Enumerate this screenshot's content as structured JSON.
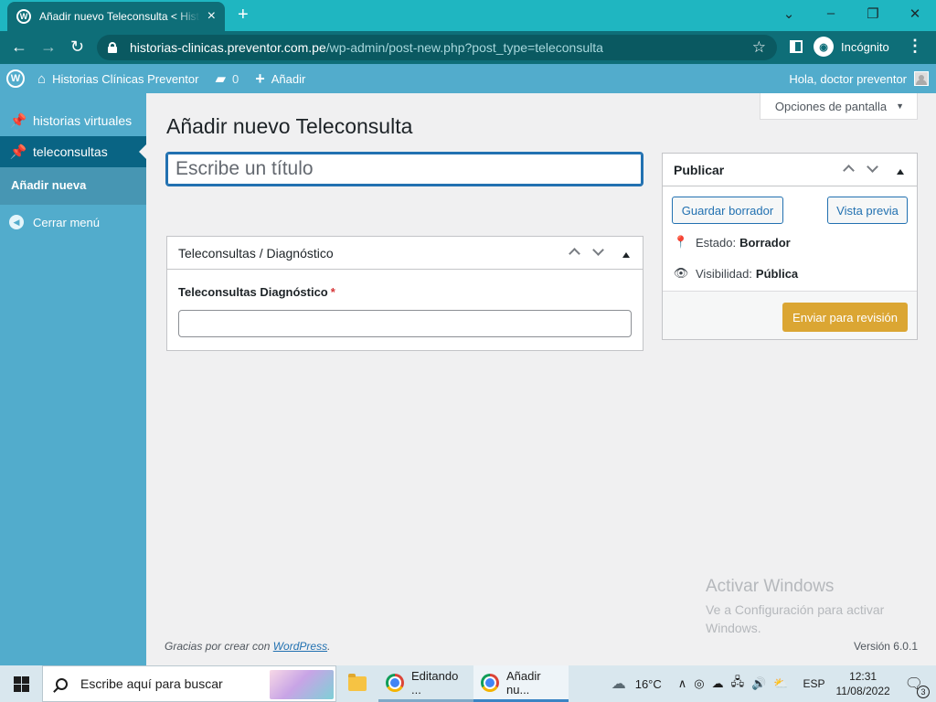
{
  "browser": {
    "tab_title": "Añadir nuevo Teleconsulta < Historias Clínicas Preventor",
    "url_host": "historias-clinicas.preventor.com.pe",
    "url_path": "/wp-admin/post-new.php?post_type=teleconsulta",
    "incognito_label": "Incógnito"
  },
  "adminbar": {
    "site_name": "Historias Clínicas Preventor",
    "comments_count": "0",
    "new_label": "Añadir",
    "howdy": "Hola, doctor preventor"
  },
  "sidebar": {
    "items": [
      {
        "label": "historias virtuales",
        "icon": "pin-icon"
      },
      {
        "label": "teleconsultas",
        "icon": "pin-icon",
        "current": true
      }
    ],
    "submenu": [
      "Añadir nueva"
    ],
    "collapse_label": "Cerrar menú"
  },
  "main": {
    "screen_options": "Opciones de pantalla",
    "page_title": "Añadir nuevo Teleconsulta",
    "title_placeholder": "Escribe un título",
    "diagnostic_box": {
      "title": "Teleconsultas / Diagnóstico",
      "field_label": "Teleconsultas Diagnóstico",
      "required_mark": "*"
    },
    "publish_box": {
      "title": "Publicar",
      "save_draft": "Guardar borrador",
      "preview": "Vista previa",
      "status_label": "Estado:",
      "status_value": "Borrador",
      "visibility_label": "Visibilidad:",
      "visibility_value": "Pública",
      "submit": "Enviar para revisión"
    },
    "footer_text": "Gracias por crear con",
    "footer_link": "WordPress",
    "footer_suffix": ".",
    "version": "Versión 6.0.1"
  },
  "watermark": {
    "title": "Activar Windows",
    "subtitle": "Ve a Configuración para activar Windows."
  },
  "taskbar": {
    "search_placeholder": "Escribe aquí para buscar",
    "apps": [
      {
        "label": "Editando ...",
        "icon": "chrome-icon"
      },
      {
        "label": "Añadir nu...",
        "icon": "chrome-icon",
        "active": true
      }
    ],
    "temperature": "16°C",
    "language": "ESP",
    "time": "12:31",
    "date": "11/08/2022",
    "notification_count": "3"
  },
  "colors": {
    "admin_accent": "#52accc",
    "current_menu": "#096484",
    "submit_button": "#dba633",
    "browser_frame": "#1fb6c1"
  }
}
